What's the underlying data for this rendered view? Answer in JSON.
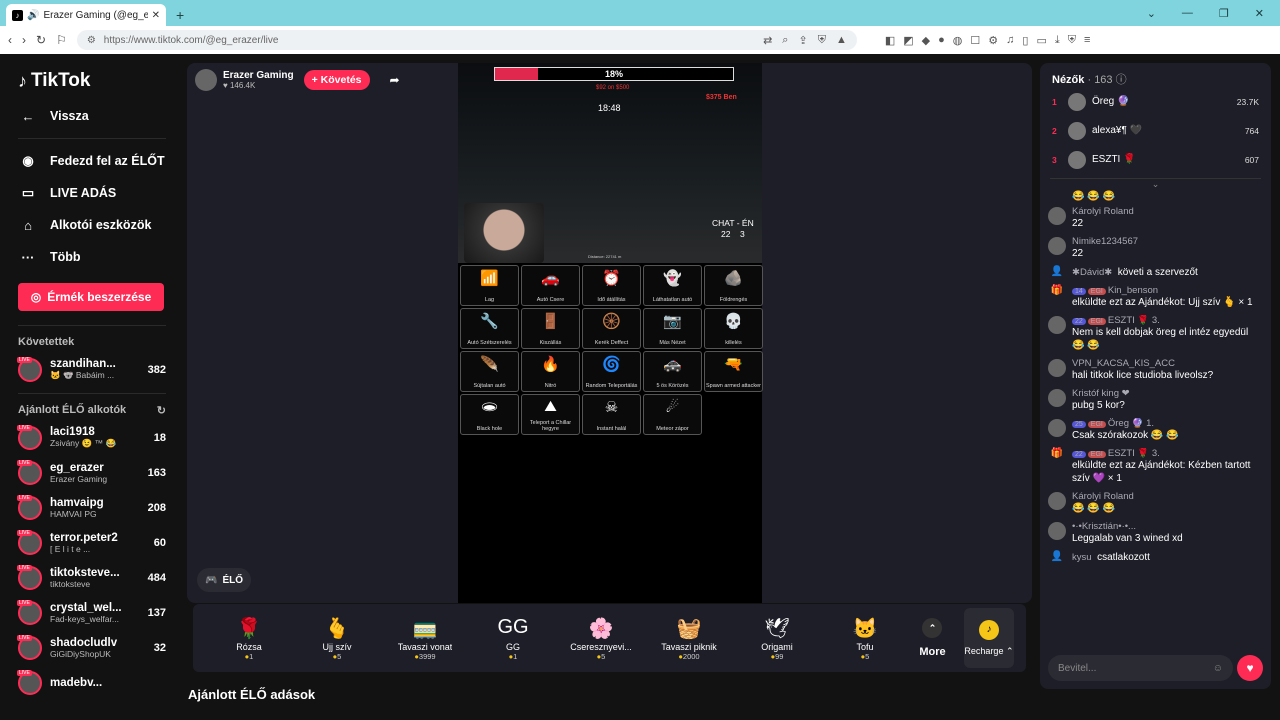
{
  "browser": {
    "tab_title": "Erazer Gaming (@eg_erazer)",
    "url": "https://www.tiktok.com/@eg_erazer/live"
  },
  "sidebar": {
    "logo": "TikTok",
    "back": "Vissza",
    "nav": [
      {
        "label": "Fedezd fel az ÉLŐT",
        "icon": "live-avatar-icon"
      },
      {
        "label": "LIVE ADÁS",
        "icon": "camera-icon"
      },
      {
        "label": "Alkotói eszközök",
        "icon": "creator-tools-icon"
      },
      {
        "label": "Több",
        "icon": "more-icon"
      }
    ],
    "buy_coins": "Érmék beszerzése",
    "following_label": "Követettek",
    "following": [
      {
        "name": "szandihan...",
        "sub": "🐱 🐨 Babáim ...",
        "count": "382"
      }
    ],
    "recommended_label": "Ajánlott ÉLŐ alkotók",
    "recommended": [
      {
        "name": "laci1918",
        "sub": "Zsivány 😉 ™ 😂",
        "count": "18"
      },
      {
        "name": "eg_erazer",
        "sub": "Erazer Gaming",
        "count": "163"
      },
      {
        "name": "hamvaipg",
        "sub": "HAMVAI PG",
        "count": "208"
      },
      {
        "name": "terror.peter2",
        "sub": "[ E l i t e ...",
        "count": "60"
      },
      {
        "name": "tiktoksteve...",
        "sub": "tiktoksteve",
        "count": "484"
      },
      {
        "name": "crystal_wel...",
        "sub": "Fad-keys_welfar...",
        "count": "137"
      },
      {
        "name": "shadocludlv",
        "sub": "GiGiDiyShopUK",
        "count": "32"
      },
      {
        "name": "madebv...",
        "sub": "",
        "count": ""
      }
    ]
  },
  "stream": {
    "streamer_name": "Erazer Gaming",
    "likes": "146.4K",
    "follow_label": "+ Követés",
    "progress_percent": 18,
    "progress_text": "18%",
    "money_a": "$92 on $500",
    "money_b": "$375 Ben",
    "clock": "18:48",
    "chat_en": "CHAT - ÉN",
    "chat_score_left": "22",
    "chat_score_right": "3",
    "distance": "Distance: 22741 m",
    "elo_label": "ÉLŐ",
    "grid": [
      {
        "label": "Lag",
        "icon": "wifi-icon"
      },
      {
        "label": "Autó Csere",
        "icon": "car-icon"
      },
      {
        "label": "Idő átállítás",
        "icon": "clock-icon"
      },
      {
        "label": "Láthatatlan autó",
        "icon": "ghost-car-icon"
      },
      {
        "label": "Földrengés",
        "icon": "rocks-icon"
      },
      {
        "label": "Autó Szétszerelés",
        "icon": "wrench-icon"
      },
      {
        "label": "Kiszállás",
        "icon": "exit-icon"
      },
      {
        "label": "Kerék Deffect",
        "icon": "wheel-icon"
      },
      {
        "label": "Más Nézet",
        "icon": "camera-view-icon"
      },
      {
        "label": "killelés",
        "icon": "skull-icon"
      },
      {
        "label": "Sújtalan autó",
        "icon": "feather-icon"
      },
      {
        "label": "Nitró",
        "icon": "nitro-icon"
      },
      {
        "label": "Random Teleportálás",
        "icon": "teleport-icon"
      },
      {
        "label": "5 ös Körözés",
        "icon": "police-icon"
      },
      {
        "label": "Spawn armed attacker",
        "icon": "attacker-icon"
      },
      {
        "label": "Black hole",
        "icon": "black-hole-icon"
      },
      {
        "label": "Teleport a Chillar hegyre",
        "icon": "mountain-icon"
      },
      {
        "label": "Instant halál",
        "icon": "death-icon"
      },
      {
        "label": "Meteor zápor",
        "icon": "meteor-icon"
      }
    ]
  },
  "gifts": [
    {
      "name": "Rózsa",
      "price": "1",
      "icon": "rose-icon"
    },
    {
      "name": "Ujj szív",
      "price": "5",
      "icon": "finger-heart-icon"
    },
    {
      "name": "Tavaszi vonat",
      "price": "3999",
      "icon": "train-icon"
    },
    {
      "name": "GG",
      "price": "1",
      "icon": "gg-icon"
    },
    {
      "name": "Cseresznyevi...",
      "price": "5",
      "icon": "cherry-blossom-icon"
    },
    {
      "name": "Tavaszi piknik",
      "price": "2000",
      "icon": "picnic-icon"
    },
    {
      "name": "Origami",
      "price": "99",
      "icon": "origami-icon"
    },
    {
      "name": "Tofu",
      "price": "5",
      "icon": "tofu-icon"
    }
  ],
  "gift_more": "More",
  "recharge": "Recharge",
  "recommended_streams_title": "Ajánlott ÉLŐ adások",
  "chat": {
    "viewers_label": "Nézők",
    "viewers_count": "· 163",
    "top": [
      {
        "rank": "1",
        "name": "Öreg",
        "badge": "🔮",
        "score": "23.7K"
      },
      {
        "rank": "2",
        "name": "alexa¥¶",
        "badge": "🖤",
        "score": "764"
      },
      {
        "rank": "3",
        "name": "ESZTI",
        "badge": "🌹",
        "score": "607"
      }
    ],
    "emoji_row": "😂 😂 😂",
    "messages": [
      {
        "name": "Károlyi Roland",
        "text": "22"
      },
      {
        "name": "Nimike1234567",
        "text": "22"
      },
      {
        "name": "✱Dávid✱",
        "text": "követi a szervezőt",
        "inline": true
      },
      {
        "badges": [
          "14",
          "EGI"
        ],
        "name": "Kin_benson",
        "text": "elküldte ezt az Ajándékot: Ujj szív 🫰 × 1"
      },
      {
        "badges": [
          "22",
          "EGI"
        ],
        "name": "ESZTI 🌹 3.",
        "text": "Nem is kell dobjak öreg el intéz egyedül 😂 😂"
      },
      {
        "name": "VPN_KACSA_KIS_ACC",
        "text": "hali titkok lice studioba liveolsz?"
      },
      {
        "name": "Kristóf king ❤",
        "text": "pubg 5 kor?"
      },
      {
        "badges": [
          "25",
          "EGI"
        ],
        "name": "Öreg 🔮 1.",
        "text": "Csak szórakozok 😂 😂"
      },
      {
        "badges": [
          "22",
          "EGI"
        ],
        "name": "ESZTI 🌹 3.",
        "text": "elküldte ezt az Ajándékot: Kézben tartott szív 💜 × 1"
      },
      {
        "name": "Károlyi Roland",
        "text": "😂 😂 😂"
      },
      {
        "name": "•·•Krisztián•·•...",
        "text": "Leggalab van 3 wined xd"
      },
      {
        "name": "kysu",
        "text": "csatlakozott",
        "inline": true
      }
    ],
    "input_placeholder": "Bevitel..."
  }
}
